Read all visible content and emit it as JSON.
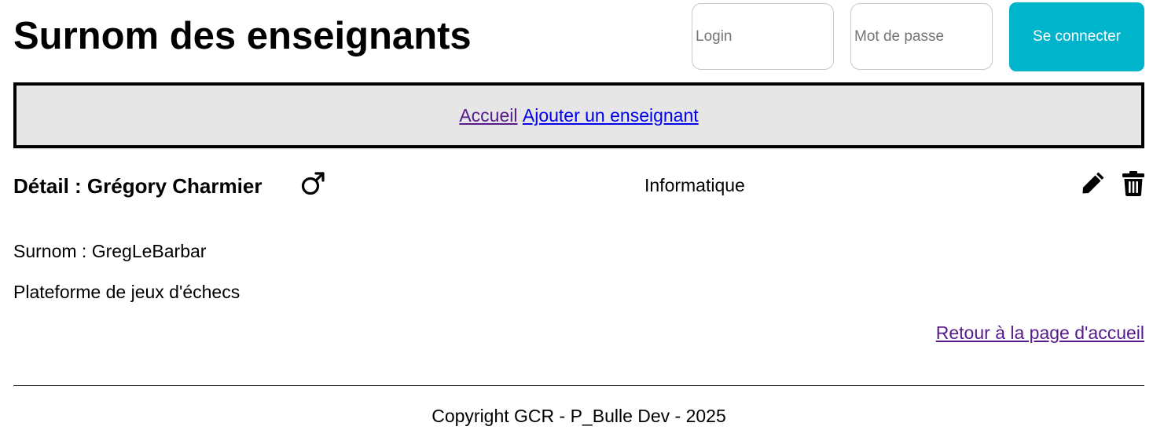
{
  "header": {
    "title": "Surnom des enseignants",
    "login_placeholder": "Login",
    "password_placeholder": "Mot de passe",
    "connect_label": "Se connecter",
    "connect_color": "#00b4cc"
  },
  "nav": {
    "home_label": "Accueil",
    "add_teacher_label": "Ajouter un enseignant",
    "background": "#e6e6e6"
  },
  "detail": {
    "title": "Détail : Grégory Charmier",
    "gender_icon": "male-symbol-icon",
    "department": "Informatique",
    "edit_icon": "pencil-icon",
    "delete_icon": "trash-icon",
    "nickname_line": "Surnom : GregLeBarbar",
    "project_line": "Plateforme de jeux d'échecs",
    "back_label": "Retour à la page d'accueil"
  },
  "footer": {
    "copyright": "Copyright GCR - P_Bulle Dev - 2025"
  }
}
